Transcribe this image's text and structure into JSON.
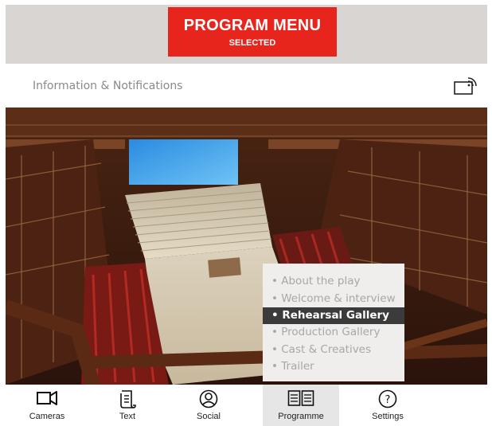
{
  "banner": {
    "title": "PROGRAM MENU",
    "subtitle": "SELECTED"
  },
  "info_bar": {
    "label": "Information & Notifications",
    "icon": "cast-icon"
  },
  "submenu": {
    "items": [
      {
        "label": "• About the play"
      },
      {
        "label": "• Welcome & interview"
      },
      {
        "label": "• Rehearsal Gallery"
      },
      {
        "label": "• Production Gallery"
      },
      {
        "label": "• Cast & Creatives"
      },
      {
        "label": "• Trailer"
      }
    ],
    "active_index": 2
  },
  "bottom_nav": {
    "items": [
      {
        "label": "Cameras",
        "icon": "camera-icon"
      },
      {
        "label": "Text",
        "icon": "scroll-icon"
      },
      {
        "label": "Social",
        "icon": "person-icon"
      },
      {
        "label": "Programme",
        "icon": "book-icon"
      },
      {
        "label": "Settings",
        "icon": "help-icon"
      }
    ],
    "active_index": 3
  },
  "colors": {
    "banner": "#e8251d",
    "active_item": "#3b3b3b",
    "submenu_bg": "#efeeec"
  }
}
